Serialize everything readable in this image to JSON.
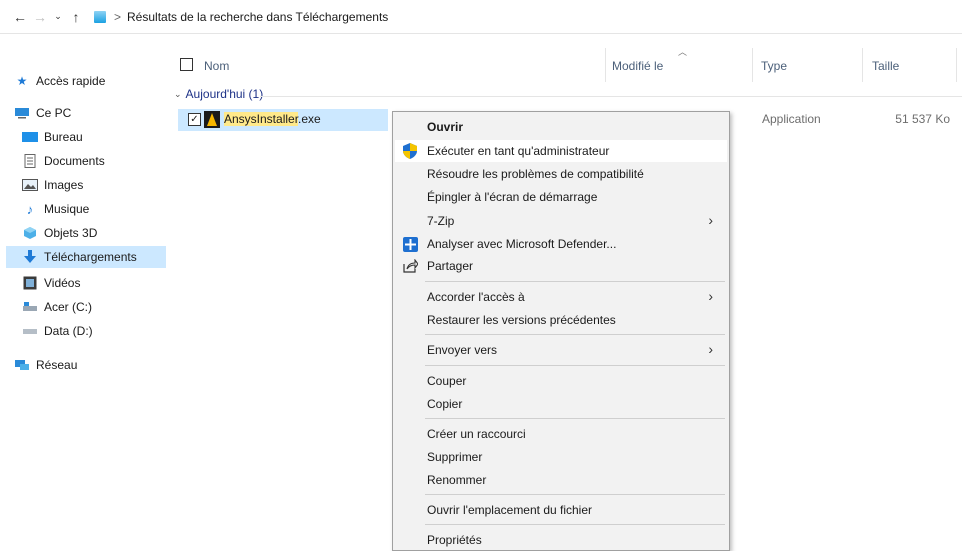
{
  "window": {
    "breadcrumb": "Résultats de la recherche dans Téléchargements"
  },
  "nav": {
    "back": "←",
    "forward": "→",
    "recent": "⌄",
    "up": "↑",
    "chevron": ">"
  },
  "sidebar": {
    "items": [
      {
        "label": "Accès rapide",
        "icon": "star-icon"
      },
      {
        "label": "Ce PC",
        "icon": "computer-icon"
      },
      {
        "label": "Bureau",
        "icon": "desktop-icon"
      },
      {
        "label": "Documents",
        "icon": "documents-icon"
      },
      {
        "label": "Images",
        "icon": "images-icon"
      },
      {
        "label": "Musique",
        "icon": "music-icon"
      },
      {
        "label": "Objets 3D",
        "icon": "3d-objects-icon"
      },
      {
        "label": "Téléchargements",
        "icon": "downloads-icon"
      },
      {
        "label": "Vidéos",
        "icon": "videos-icon"
      },
      {
        "label": "Acer (C:)",
        "icon": "drive-c-icon"
      },
      {
        "label": "Data (D:)",
        "icon": "drive-d-icon"
      },
      {
        "label": "Réseau",
        "icon": "network-icon"
      }
    ]
  },
  "columns": {
    "name": "Nom",
    "modified": "Modifié le",
    "type": "Type",
    "size": "Taille"
  },
  "group": {
    "label": "Aujourd'hui (1)"
  },
  "file": {
    "name_highlight": "AnsysInstaller",
    "name_ext": ".exe",
    "type": "Application",
    "size": "51 537 Ko",
    "checked": "✓"
  },
  "context_menu": {
    "open": "Ouvrir",
    "run_as_admin": "Exécuter en tant qu'administrateur",
    "troubleshoot": "Résoudre les problèmes de compatibilité",
    "pin_start": "Épingler à l'écran de démarrage",
    "zip": "7-Zip",
    "defender": "Analyser avec Microsoft Defender...",
    "share": "Partager",
    "give_access": "Accorder l'accès à",
    "restore": "Restaurer les versions précédentes",
    "send_to": "Envoyer vers",
    "cut": "Couper",
    "copy": "Copier",
    "shortcut": "Créer un raccourci",
    "delete": "Supprimer",
    "rename": "Renommer",
    "open_location": "Ouvrir l'emplacement du fichier",
    "properties": "Propriétés",
    "arrow": "›"
  },
  "colors": {
    "selection": "#cce8ff",
    "menu_bg": "#f2f2f2",
    "highlight": "#ffe98a"
  }
}
